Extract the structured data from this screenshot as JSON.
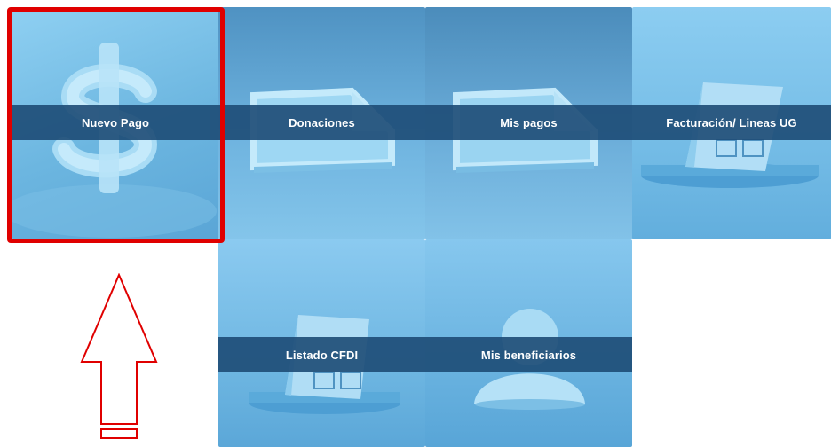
{
  "tiles": [
    {
      "label": "Nuevo Pago",
      "icon": "dollar-icon"
    },
    {
      "label": "Donaciones",
      "icon": "document-icon"
    },
    {
      "label": "Mis pagos",
      "icon": "document-icon"
    },
    {
      "label": "Facturación/ Lineas UG",
      "icon": "invoice-icon"
    },
    {
      "label": "Listado CFDI",
      "icon": "invoice-icon"
    },
    {
      "label": "Mis beneficiarios",
      "icon": "person-icon"
    }
  ],
  "annotation": {
    "highlight_color": "#e00000",
    "arrow_color": "#e00000"
  },
  "colors": {
    "label_band": "#1d4b76",
    "tile_blue": "#6cb6e0"
  }
}
